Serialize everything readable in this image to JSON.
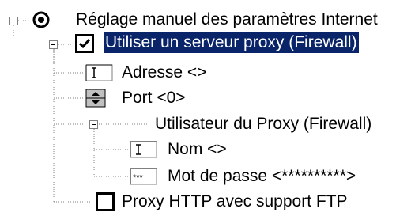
{
  "tree": {
    "root": {
      "label": "Réglage manuel des paramètres Internet",
      "radio_selected": true
    },
    "proxy": {
      "label": "Utiliser un serveur proxy (Firewall)",
      "checked": true,
      "selected": true
    },
    "address": {
      "label": "Adresse <>",
      "icon": "text-field-icon"
    },
    "port": {
      "label": "Port <0>",
      "icon": "spinner-icon"
    },
    "user_group": {
      "label": "Utilisateur du Proxy (Firewall)"
    },
    "name": {
      "label": "Nom <>",
      "icon": "text-field-icon"
    },
    "password": {
      "label": "Mot de passe <**********>",
      "icon": "password-field-icon"
    },
    "http_ftp": {
      "label": "Proxy HTTP avec support FTP",
      "checked": false
    }
  },
  "colors": {
    "selection": "#0a246a",
    "tree_line": "#808080"
  }
}
